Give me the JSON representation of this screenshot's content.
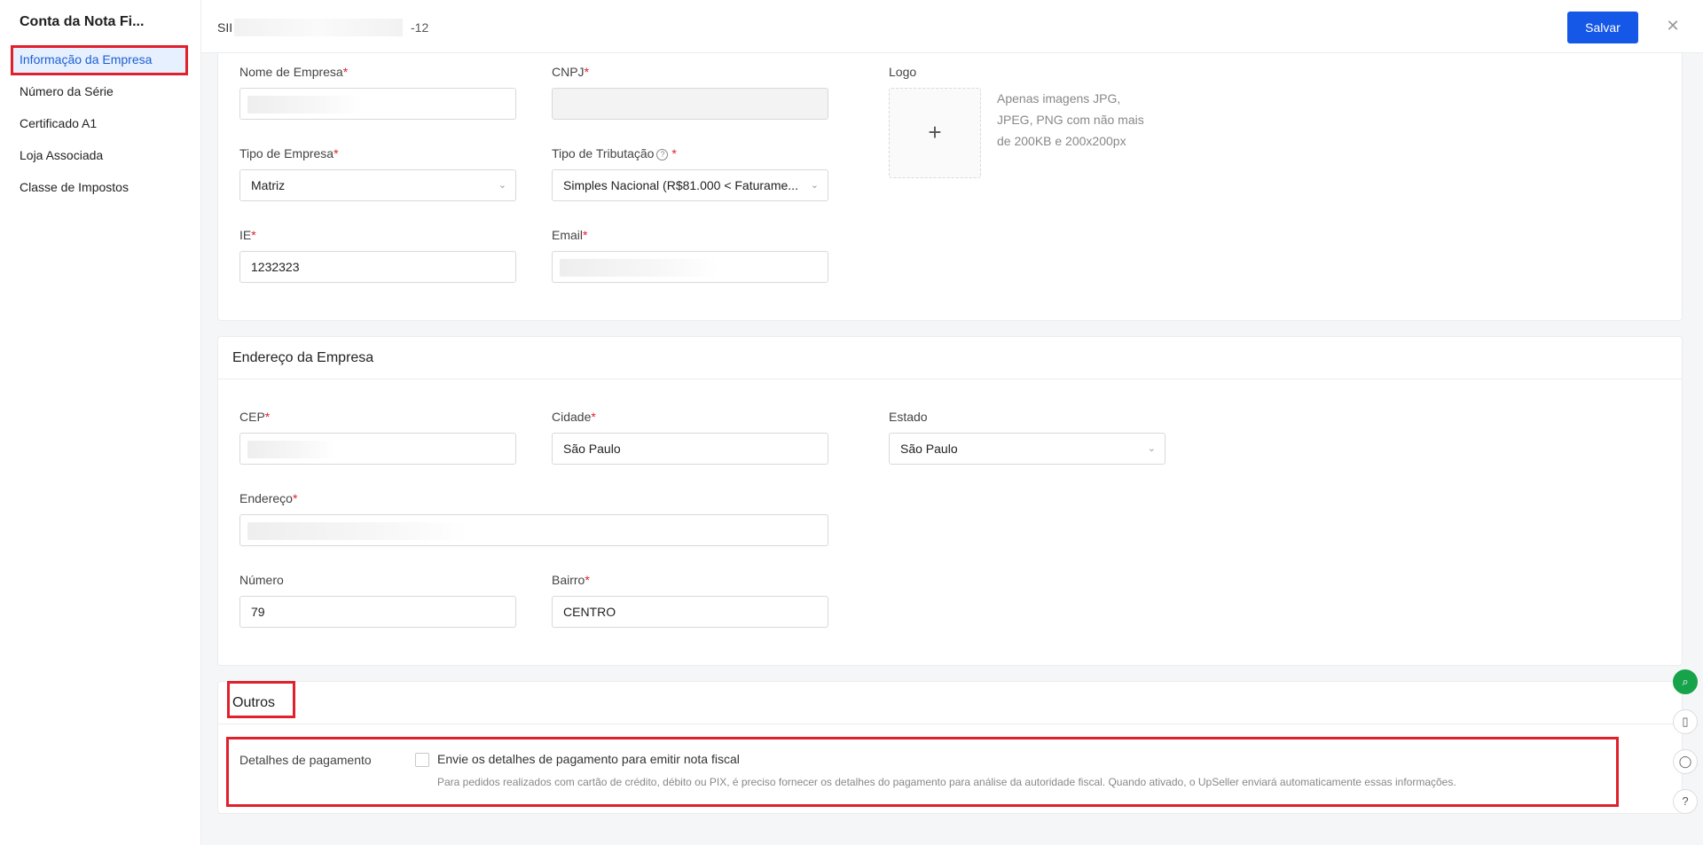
{
  "sidebar": {
    "title": "Conta da Nota Fi...",
    "items": [
      {
        "label": "Informação da Empresa"
      },
      {
        "label": "Número da Série"
      },
      {
        "label": "Certificado A1"
      },
      {
        "label": "Loja Associada"
      },
      {
        "label": "Classe de Impostos"
      }
    ]
  },
  "topbar": {
    "title_prefix": "SII",
    "title_suffix": "-12",
    "save_label": "Salvar",
    "close_glyph": "✕"
  },
  "company": {
    "nome_label": "Nome de Empresa",
    "cnpj_label": "CNPJ",
    "logo_label": "Logo",
    "upload_glyph": "+",
    "upload_hint": "Apenas imagens JPG, JPEG, PNG com não mais de 200KB e 200x200px",
    "tipo_empresa_label": "Tipo de Empresa",
    "tipo_empresa_value": "Matriz",
    "tipo_tributacao_label": "Tipo de Tributação",
    "tipo_tributacao_value": "Simples Nacional (R$81.000 < Faturame...",
    "ie_label": "IE",
    "ie_value": "1232323",
    "email_label": "Email"
  },
  "address": {
    "header": "Endereço da Empresa",
    "cep_label": "CEP",
    "cidade_label": "Cidade",
    "cidade_value": "São Paulo",
    "estado_label": "Estado",
    "estado_value": "São Paulo",
    "endereco_label": "Endereço",
    "numero_label": "Número",
    "numero_value": "79",
    "bairro_label": "Bairro",
    "bairro_value": "CENTRO"
  },
  "outros": {
    "header": "Outros",
    "payment_label": "Detalhes de pagamento",
    "checkbox_label": "Envie os detalhes de pagamento para emitir nota fiscal",
    "checkbox_checked": false,
    "payment_hint": "Para pedidos realizados com cartão de crédito, débito ou PIX, é preciso fornecer os detalhes do pagamento para análise da autoridade fiscal. Quando ativado, o UpSeller enviará automaticamente essas informações."
  },
  "required_mark": "*",
  "help_glyph": "?",
  "chevron_glyph": "⌄",
  "floating": {
    "search_glyph": "⌕",
    "phone_glyph": "▯",
    "chat_glyph": "◯",
    "help_glyph": "?"
  },
  "colors": {
    "accent": "#1557e6",
    "required": "#e0202a",
    "active_bg": "#e7f0fe",
    "highlight": "#e0202a",
    "float_green": "#16a34a"
  }
}
